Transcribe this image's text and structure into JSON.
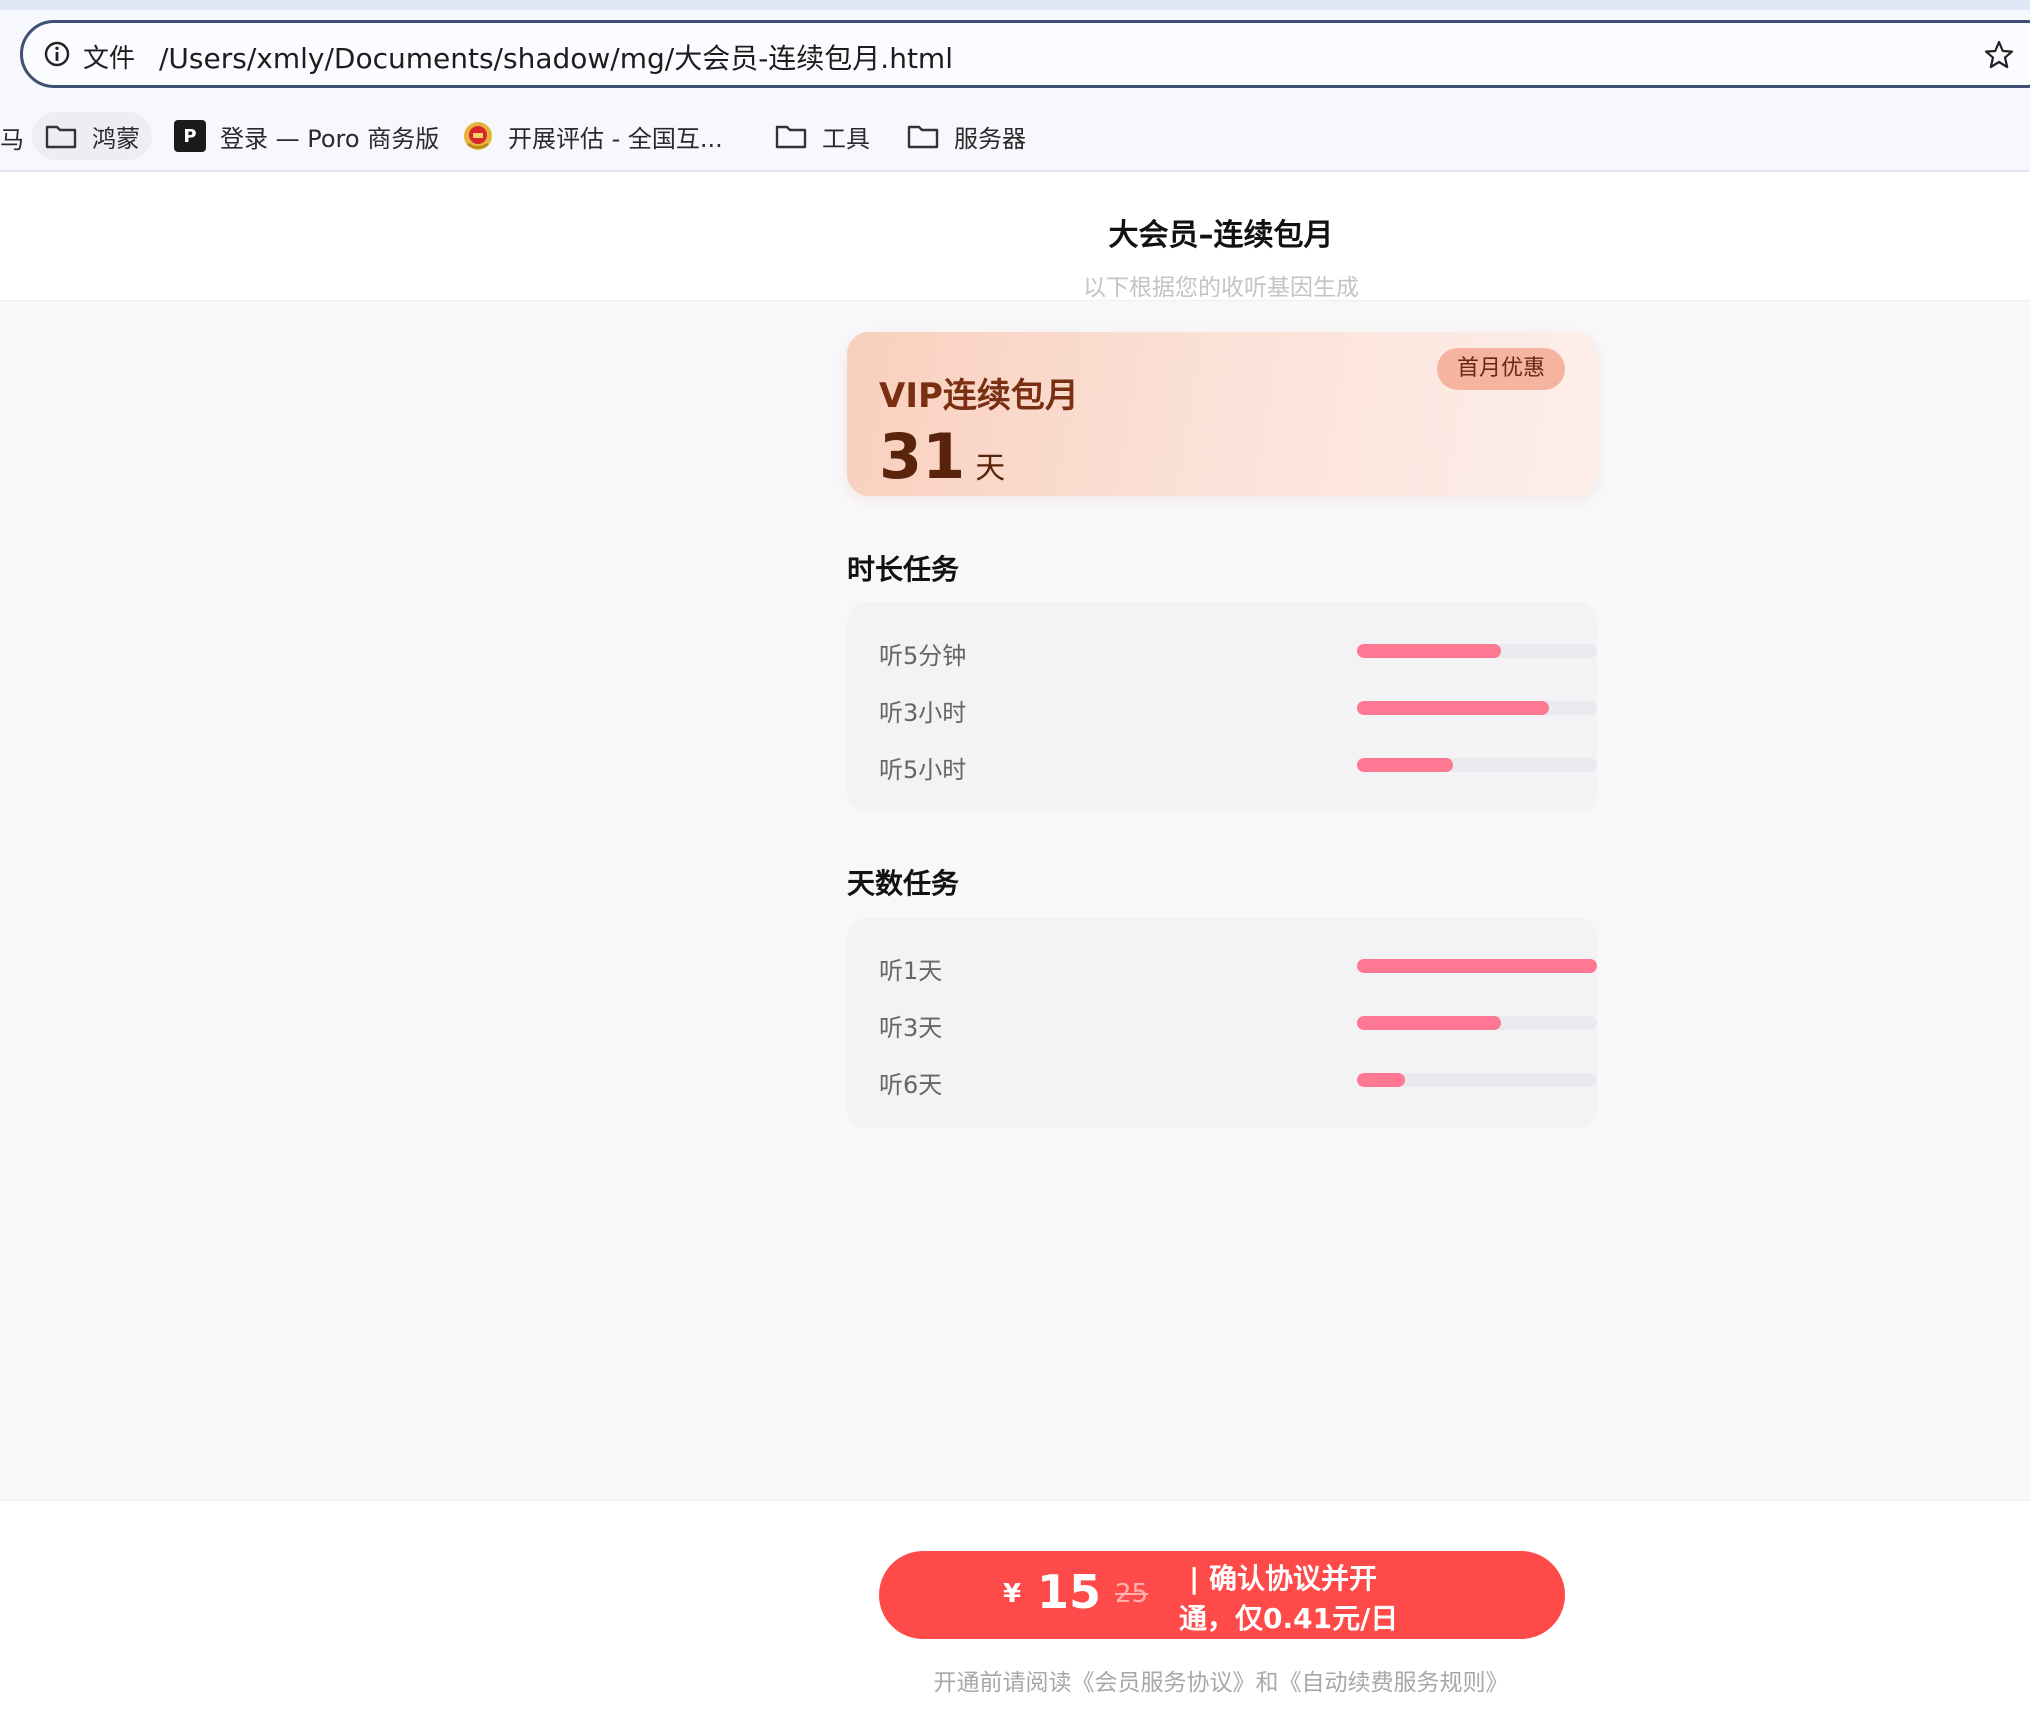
{
  "browser": {
    "file_label": "文件",
    "url": "/Users/xmly/Documents/shadow/mg/大会员-连续包月.html",
    "bookmarks": {
      "edge_fragment": "马",
      "hongmeng": "鸿蒙",
      "poro": "登录 — Poro 商务版",
      "poro_logo": "P",
      "kaizhan": "开展评估 - 全国互...",
      "tools": "工具",
      "server": "服务器"
    }
  },
  "header": {
    "title": "大会员–连续包月",
    "subtitle": "以下根据您的收听基因生成"
  },
  "vip_card": {
    "name": "VIP连续包月",
    "days_value": "31",
    "days_unit": "天",
    "badge": "首月优惠"
  },
  "duration_tasks": {
    "title": "时长任务",
    "items": [
      {
        "label": "听5分钟",
        "progress": 0.6
      },
      {
        "label": "听3小时",
        "progress": 0.8
      },
      {
        "label": "听5小时",
        "progress": 0.4
      }
    ]
  },
  "day_tasks": {
    "title": "天数任务",
    "items": [
      {
        "label": "听1天",
        "progress": 1.0
      },
      {
        "label": "听3天",
        "progress": 0.6
      },
      {
        "label": "听6天",
        "progress": 0.2
      }
    ]
  },
  "footer": {
    "currency": "¥",
    "price": "15",
    "original_price": "25",
    "button_line1": "| 确认协议并开",
    "button_line2": "通，仅0.41元/日",
    "agreement": "开通前请阅读《会员服务协议》和《自动续费服务规则》"
  },
  "colors": {
    "progress_fill": "#ff7893",
    "progress_track": "#e9e9ee",
    "button": "#ff4a4a",
    "vip_text": "#7a2f12"
  }
}
